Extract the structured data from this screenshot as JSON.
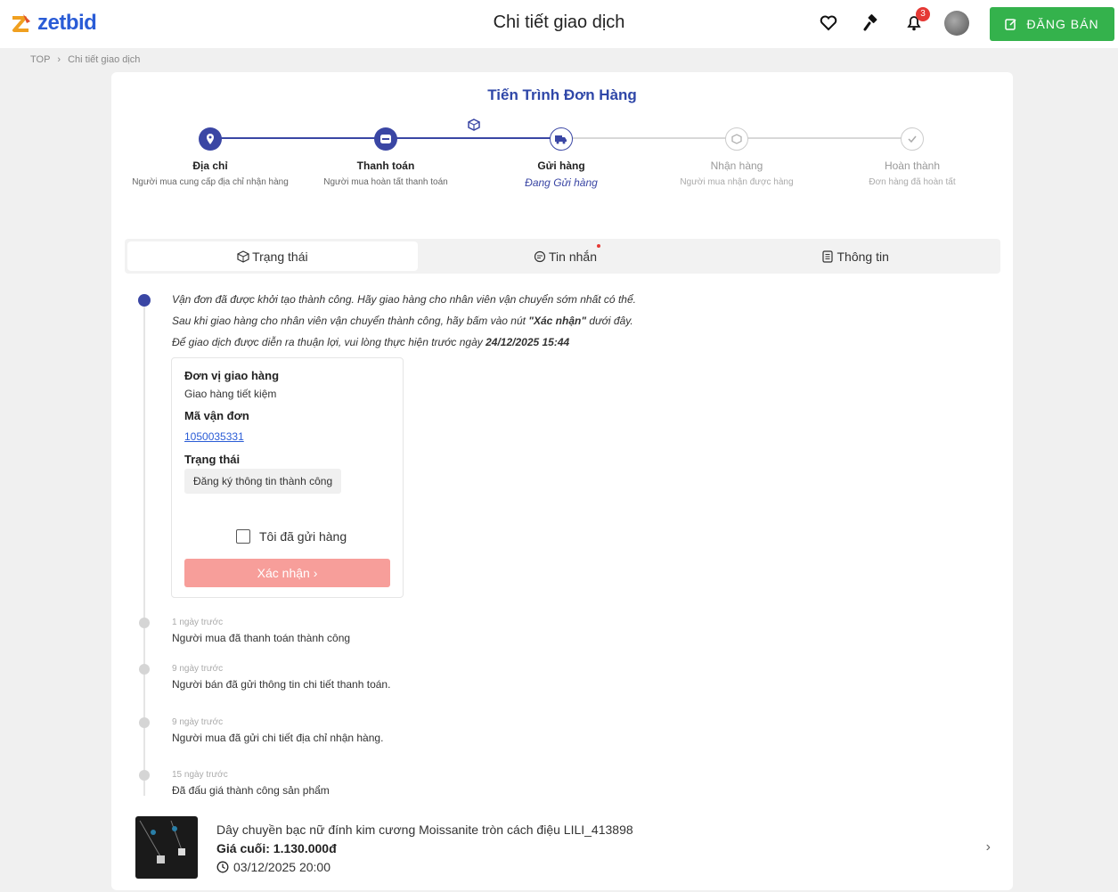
{
  "header": {
    "logo_text": "zetbid",
    "title": "Chi tiết giao dịch",
    "notification_count": "3",
    "post_button_label": "ĐĂNG BÁN",
    "brand_color": "#2a5cd6",
    "post_button_color": "#34b24c"
  },
  "breadcrumb": {
    "home": "TOP",
    "current": "Chi tiết giao dịch"
  },
  "progress": {
    "title": "Tiến Trình Đơn Hàng",
    "steps": [
      {
        "name": "Địa chỉ",
        "desc": "Người mua cung cấp địa chỉ nhận hàng",
        "state": "done",
        "icon": "location-icon"
      },
      {
        "name": "Thanh toán",
        "desc": "Người mua hoàn tất thanh toán",
        "state": "done",
        "icon": "payment-icon"
      },
      {
        "name": "Gửi hàng",
        "desc": "Đang Gửi hàng",
        "state": "active",
        "icon": "truck-icon"
      },
      {
        "name": "Nhận hàng",
        "desc": "Người mua nhận được hàng",
        "state": "todo",
        "icon": "box-icon"
      },
      {
        "name": "Hoàn thành",
        "desc": "Đơn hàng đã hoàn tất",
        "state": "todo",
        "icon": "check-icon"
      }
    ]
  },
  "tabs": [
    {
      "label": "Trạng thái",
      "active": true,
      "icon": "package-icon"
    },
    {
      "label": "Tin nhắn",
      "active": false,
      "icon": "chat-icon"
    },
    {
      "label": "Thông tin",
      "active": false,
      "icon": "document-icon"
    }
  ],
  "current_event": {
    "line1": "Vận đơn đã được khởi tạo thành công. Hãy giao hàng cho nhân viên vận chuyển sớm nhất có thể.",
    "line2_prefix": "Sau khi giao hàng cho nhân viên vận chuyển thành công, hãy bấm vào nút ",
    "line2_bold": "\"Xác nhận\"",
    "line2_suffix": " dưới đây.",
    "line3_prefix": "Để giao dịch được diễn ra thuận lợi, vui lòng thực hiện trước ngày ",
    "line3_bold": "24/12/2025 15:44"
  },
  "shipping": {
    "carrier_label": "Đơn vị giao hàng",
    "carrier_value": "Giao hàng tiết kiệm",
    "tracking_label": "Mã vận đơn",
    "tracking_value": "1050035331",
    "status_label": "Trạng thái",
    "status_value": "Đăng ký thông tin thành công",
    "checkbox_label": "Tôi đã gửi hàng",
    "confirm_label": "Xác nhận  ›"
  },
  "events": [
    {
      "time": "1 ngày trước",
      "text": "Người mua đã thanh toán thành công"
    },
    {
      "time": "9 ngày trước",
      "text": "Người bán đã gửi thông tin chi tiết thanh toán."
    },
    {
      "time": "9 ngày trước",
      "text": "Người mua đã gửi chi tiết địa chỉ nhận hàng."
    },
    {
      "time": "15 ngày trước",
      "text": "Đã đấu giá thành công sản phẩm"
    }
  ],
  "product": {
    "name": "Dây chuyền bạc nữ đính kim cương Moissanite tròn cách điệu LILI_413898",
    "price": "Giá cuối:  1.130.000đ",
    "date": "03/12/2025 20:00"
  }
}
